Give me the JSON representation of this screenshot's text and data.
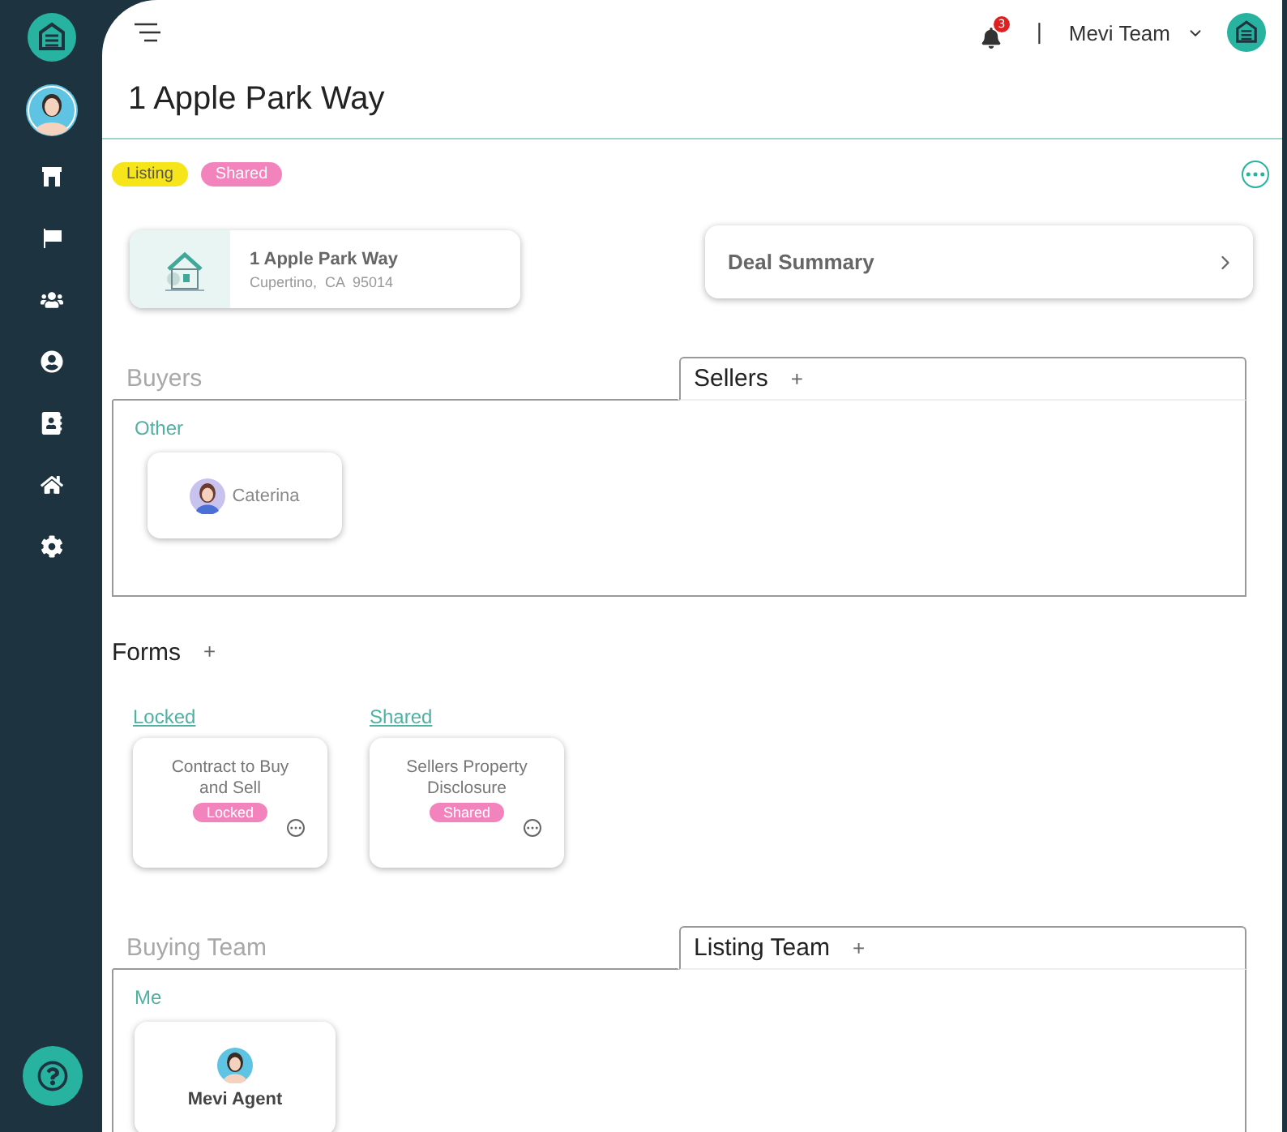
{
  "header": {
    "notifications": "3",
    "separator": "|",
    "team": "Mevi Team"
  },
  "title": "1 Apple Park Way",
  "tags": [
    {
      "label": "Listing",
      "color": "#f7e51c"
    },
    {
      "label": "Shared",
      "color": "#f383bd"
    }
  ],
  "property": {
    "name": "1 Apple Park Way",
    "address": "Cupertino,  CA  95014"
  },
  "deal_summary": {
    "label": "Deal Summary"
  },
  "contacts": {
    "tabs": [
      {
        "label": "Buyers",
        "selected": false
      },
      {
        "label": "Sellers",
        "selected": true,
        "action": "+"
      }
    ],
    "groups": [
      {
        "label": "Other",
        "people": [
          {
            "name": "Caterina"
          }
        ]
      }
    ]
  },
  "forms": {
    "title": "Forms",
    "action": "+",
    "groups": [
      {
        "label": "Locked",
        "cards": [
          {
            "title": "Contract to Buy and Sell",
            "status": "Locked"
          }
        ]
      },
      {
        "label": "Shared",
        "cards": [
          {
            "title": "Sellers Property Disclosure",
            "status": "Shared"
          }
        ]
      }
    ]
  },
  "team": {
    "tabs": [
      {
        "label": "Buying Team",
        "selected": false
      },
      {
        "label": "Listing Team",
        "selected": true,
        "action": "+"
      }
    ],
    "groups": [
      {
        "label": "Me",
        "people": [
          {
            "name": "Mevi Agent"
          }
        ]
      }
    ]
  }
}
